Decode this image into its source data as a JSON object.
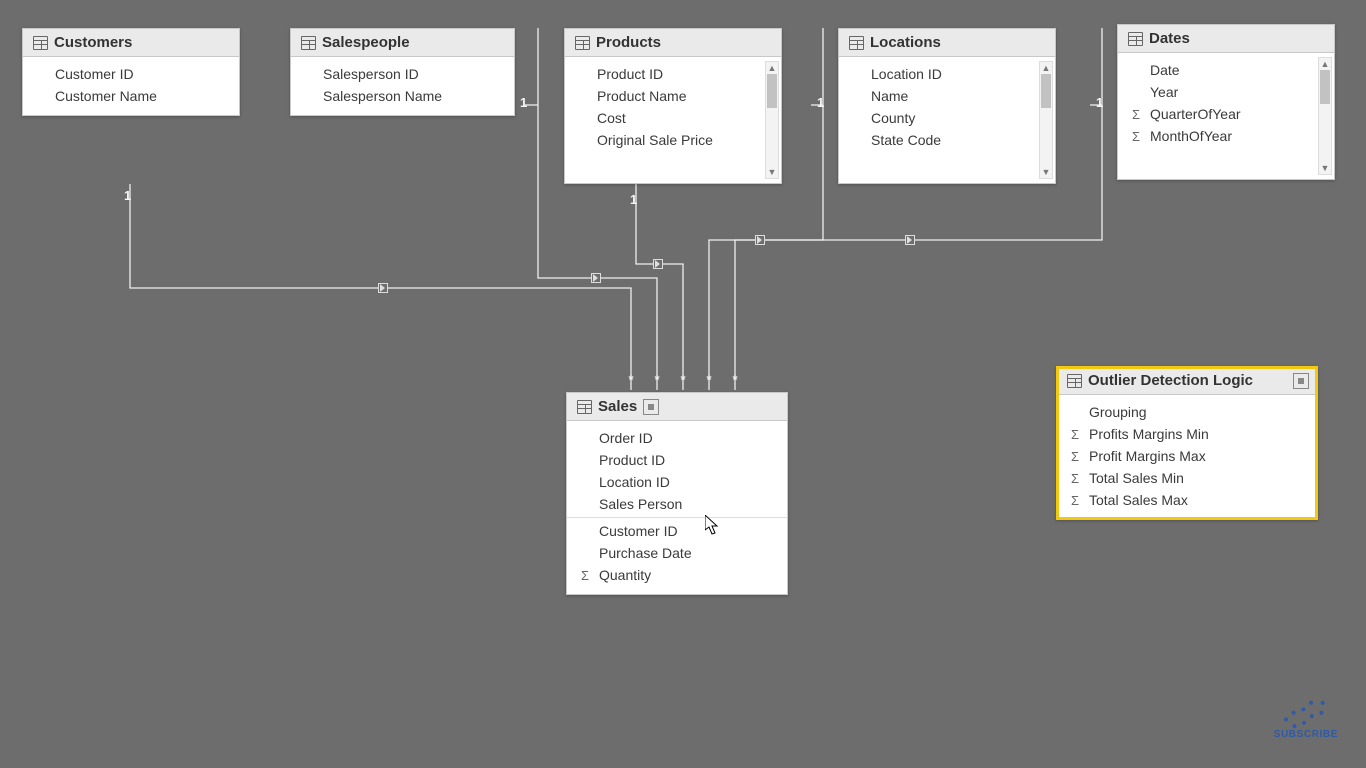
{
  "tables": {
    "customers": {
      "title": "Customers",
      "fields": [
        "Customer ID",
        "Customer Name"
      ]
    },
    "salespeople": {
      "title": "Salespeople",
      "fields": [
        "Salesperson ID",
        "Salesperson Name"
      ]
    },
    "products": {
      "title": "Products",
      "fields": [
        "Product ID",
        "Product Name",
        "Cost",
        "Original Sale Price"
      ]
    },
    "locations": {
      "title": "Locations",
      "fields": [
        "Location ID",
        "Name",
        "County",
        "State Code"
      ]
    },
    "dates": {
      "title": "Dates",
      "fields": [
        {
          "label": "Date",
          "sigma": false
        },
        {
          "label": "Year",
          "sigma": false
        },
        {
          "label": "QuarterOfYear",
          "sigma": true
        },
        {
          "label": "MonthOfYear",
          "sigma": true
        }
      ]
    },
    "sales": {
      "title": "Sales",
      "fields": [
        {
          "label": "Order ID",
          "sigma": false
        },
        {
          "label": "Product ID",
          "sigma": false
        },
        {
          "label": "Location ID",
          "sigma": false
        },
        {
          "label": "Sales Person",
          "sigma": false
        },
        {
          "divider": true
        },
        {
          "label": "Customer ID",
          "sigma": false
        },
        {
          "label": "Purchase Date",
          "sigma": false
        },
        {
          "label": "Quantity",
          "sigma": true
        }
      ]
    },
    "outlier": {
      "title": "Outlier Detection Logic",
      "fields": [
        {
          "label": "Grouping",
          "sigma": false
        },
        {
          "label": "Profits Margins Min",
          "sigma": true
        },
        {
          "label": "Profit Margins Max",
          "sigma": true
        },
        {
          "label": "Total Sales Min",
          "sigma": true
        },
        {
          "label": "Total Sales Max",
          "sigma": true
        }
      ]
    }
  },
  "rel": {
    "one": "1",
    "many": "*"
  },
  "watermark": "SUBSCRIBE"
}
